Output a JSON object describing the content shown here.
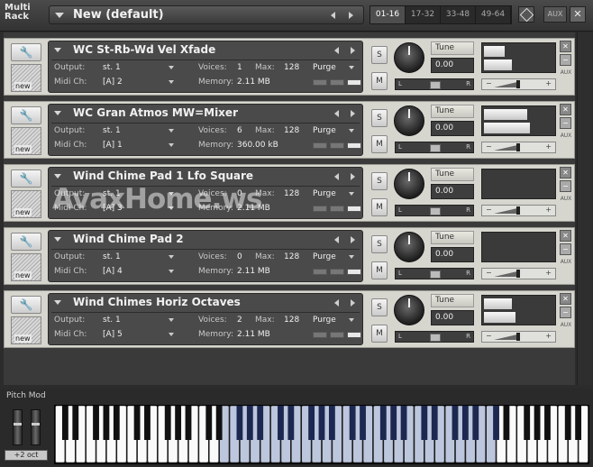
{
  "header": {
    "title_line1": "Multi",
    "title_line2": "Rack",
    "rack_name": "New (default)",
    "pages": [
      "01-16",
      "17-32",
      "33-48",
      "49-64"
    ],
    "active_page": 0,
    "aux_label": "AUX",
    "close_label": "✕"
  },
  "labels": {
    "output": "Output:",
    "voices": "Voices:",
    "max": "Max:",
    "purge": "Purge",
    "midi_ch": "Midi Ch:",
    "memory": "Memory:",
    "tune": "Tune",
    "solo": "S",
    "mute": "M",
    "new": "new",
    "pan_left": "L",
    "pan_right": "R",
    "minus": "−",
    "plus": "+",
    "aux": "AUX",
    "close": "✕",
    "minimize": "−",
    "wrench": "🔧"
  },
  "instruments": [
    {
      "name": "WC St-Rb-Wd Vel Xfade",
      "output": "st. 1",
      "voices": "1",
      "max": "128",
      "midi": "[A]  2",
      "memory": "2.11 MB",
      "tune": "0.00",
      "meter_l": 0.3,
      "meter_r": 0.4
    },
    {
      "name": "WC Gran Atmos MW=Mixer",
      "output": "st. 1",
      "voices": "6",
      "max": "128",
      "midi": "[A]  1",
      "memory": "360.00 kB",
      "tune": "0.00",
      "meter_l": 0.62,
      "meter_r": 0.66
    },
    {
      "name": "Wind Chime Pad 1 Lfo Square",
      "output": "st. 1",
      "voices": "0",
      "max": "128",
      "midi": "[A]  3",
      "memory": "2.11 MB",
      "tune": "0.00",
      "meter_l": 0,
      "meter_r": 0
    },
    {
      "name": "Wind Chime Pad 2",
      "output": "st. 1",
      "voices": "0",
      "max": "128",
      "midi": "[A]  4",
      "memory": "2.11 MB",
      "tune": "0.00",
      "meter_l": 0,
      "meter_r": 0
    },
    {
      "name": "Wind Chimes Horiz Octaves",
      "output": "st. 1",
      "voices": "2",
      "max": "128",
      "midi": "[A]  5",
      "memory": "2.11 MB",
      "tune": "0.00",
      "meter_l": 0.4,
      "meter_r": 0.45
    }
  ],
  "watermark": "AvaxHome.ws",
  "keyboard": {
    "pitch_mod_label": "Pitch Mod",
    "octave_label": "+2 oct",
    "white_keys": 52,
    "highlight_start": 16,
    "highlight_end": 43
  },
  "colors": {
    "panel": "#d6d6cf",
    "header": "#4a4a4a",
    "highlight_key": "#bcc6dc"
  }
}
